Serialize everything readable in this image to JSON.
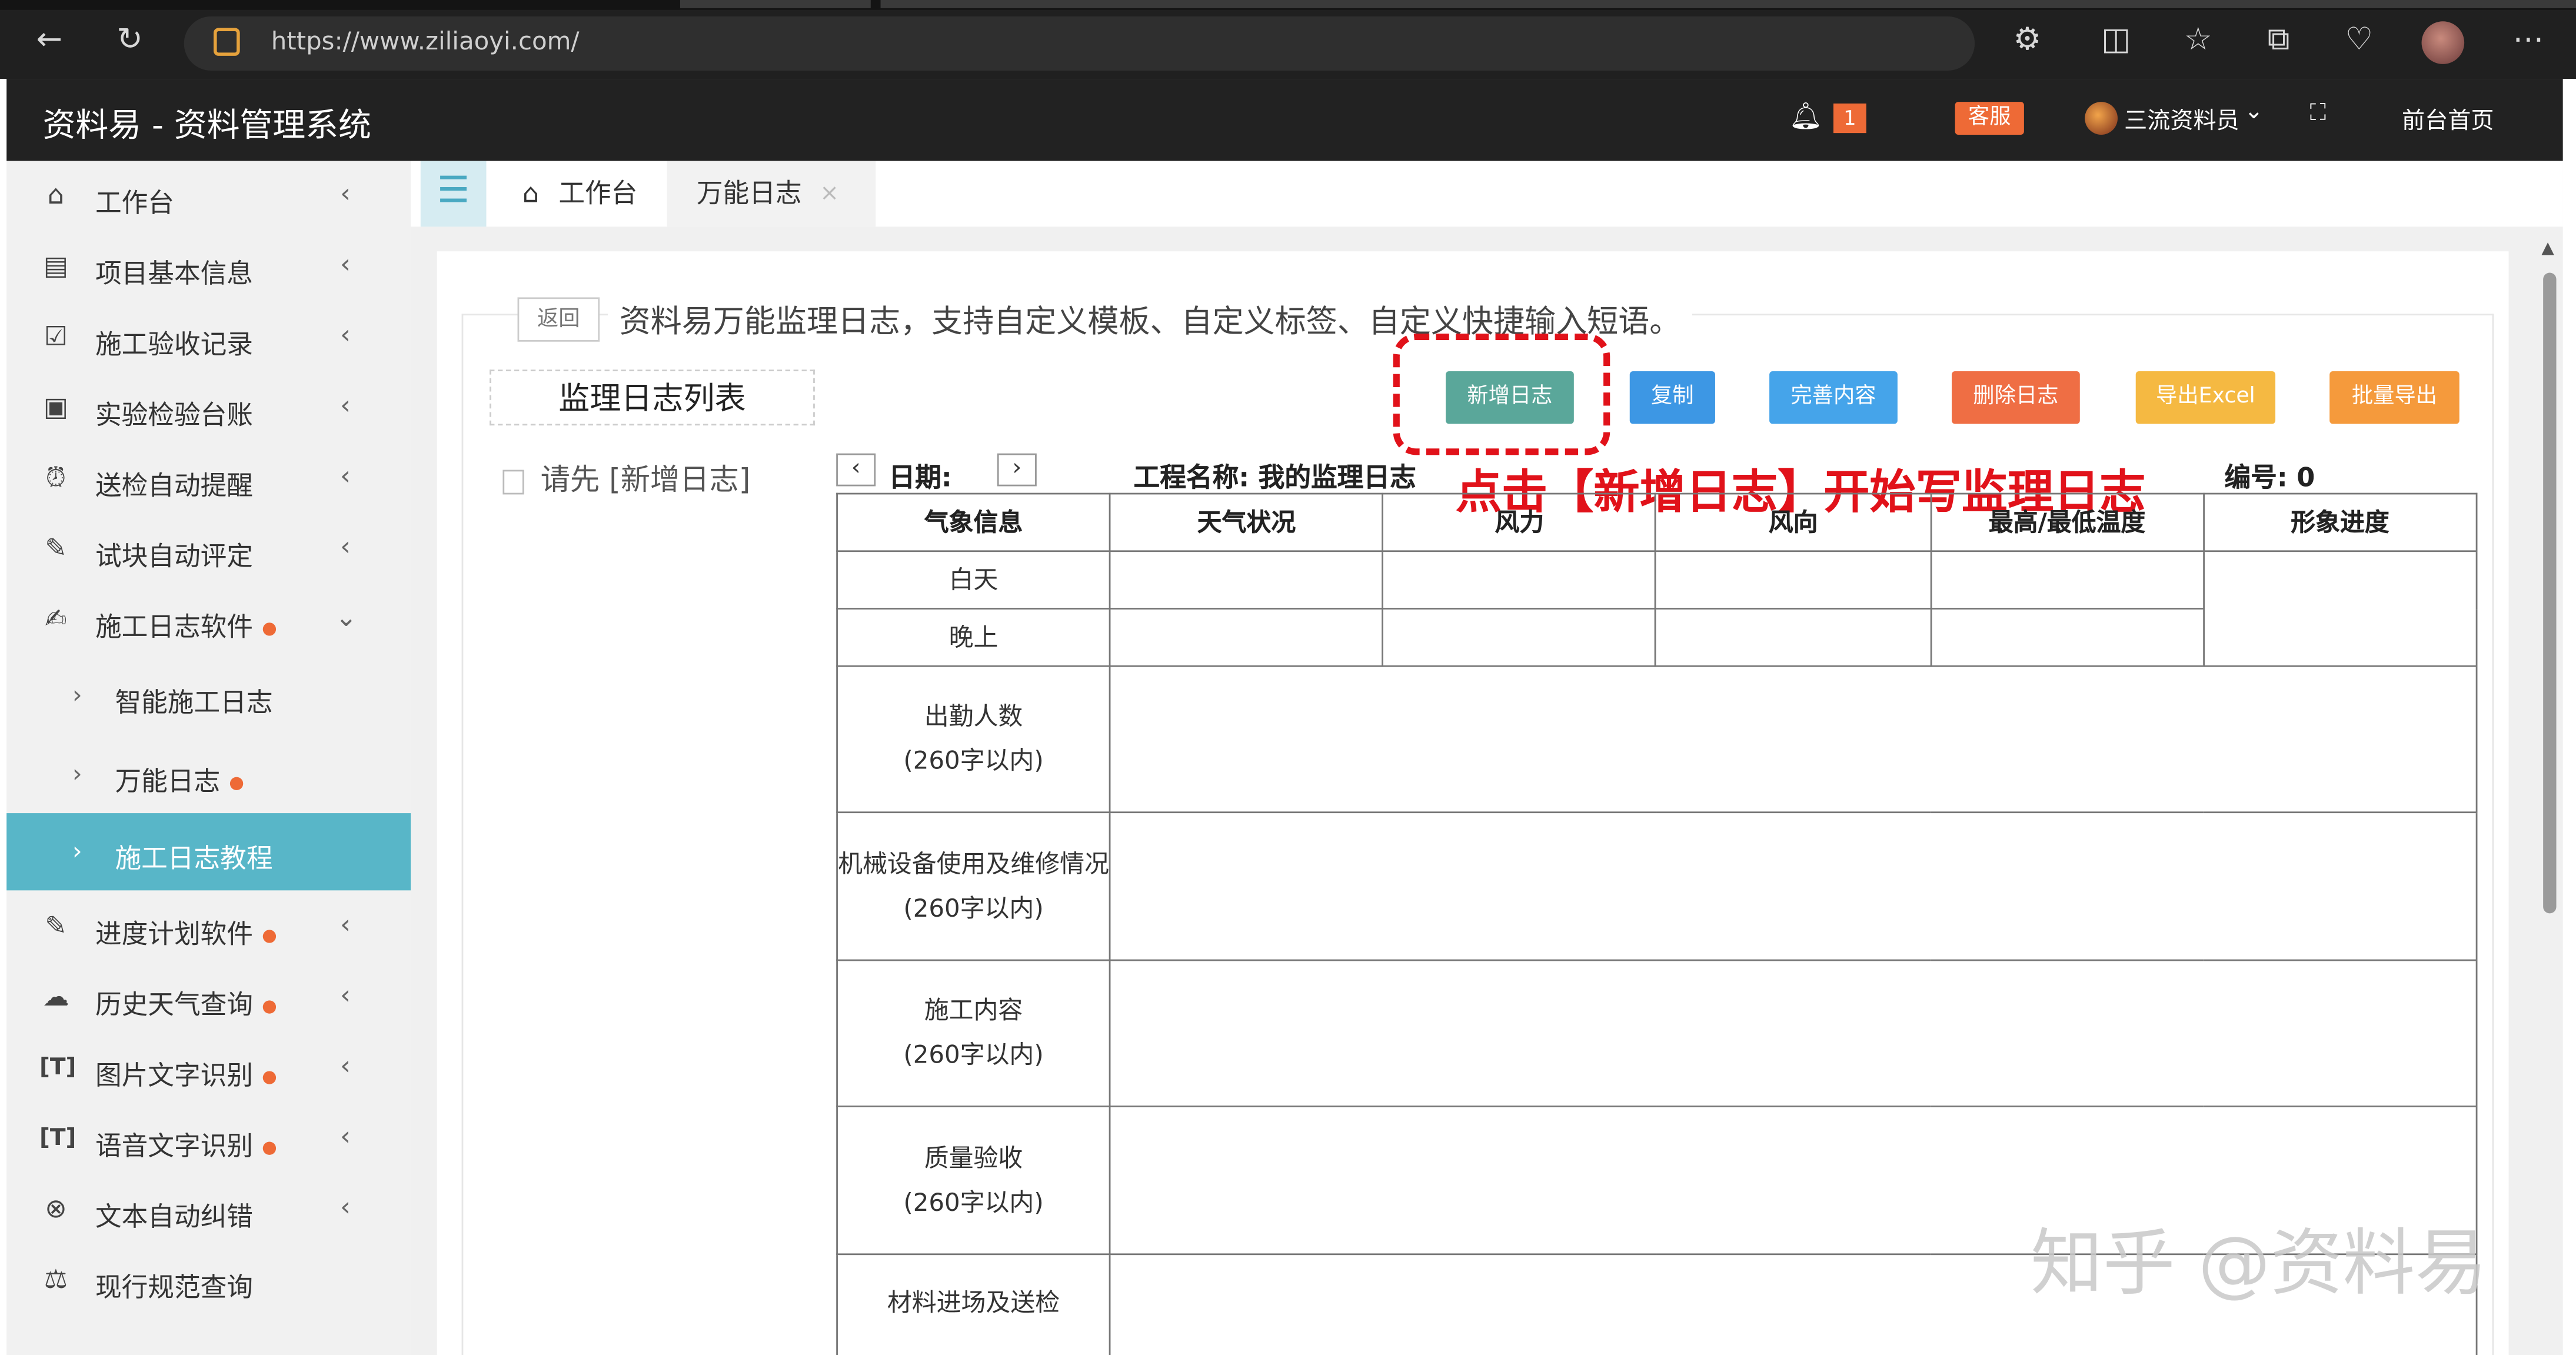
{
  "browser": {
    "url": "https://www.ziliaoyi.com/"
  },
  "header": {
    "app_title": "资料易 - 资料管理系统",
    "notification_count": "1",
    "support_label": "客服",
    "user_name": "三流资料员",
    "front_page_label": "前台首页"
  },
  "sidebar": {
    "items": [
      {
        "label": "工作台",
        "icon": "home-icon"
      },
      {
        "label": "项目基本信息",
        "icon": "document-icon"
      },
      {
        "label": "施工验收记录",
        "icon": "checklist-icon"
      },
      {
        "label": "实验检验台账",
        "icon": "inspection-icon"
      },
      {
        "label": "送检自动提醒",
        "icon": "alarm-clock-icon"
      },
      {
        "label": "试块自动评定",
        "icon": "assessment-icon"
      },
      {
        "label": "施工日志软件",
        "icon": "log-edit-icon"
      },
      {
        "label": "智能施工日志"
      },
      {
        "label": "万能日志"
      },
      {
        "label": "施工日志教程"
      },
      {
        "label": "进度计划软件",
        "icon": "schedule-icon"
      },
      {
        "label": "历史天气查询",
        "icon": "weather-icon"
      },
      {
        "label": "图片文字识别",
        "icon": "ocr-text-icon"
      },
      {
        "label": "语音文字识别",
        "icon": "voice-text-icon"
      },
      {
        "label": "文本自动纠错",
        "icon": "proofread-icon"
      },
      {
        "label": "现行规范查询",
        "icon": "scale-icon"
      }
    ]
  },
  "tabs": [
    {
      "label": "工作台",
      "icon": "home-icon"
    },
    {
      "label": "万能日志",
      "close": "×"
    }
  ],
  "page": {
    "back_label": "返回",
    "legend": "资料易万能监理日志，支持自定义模板、自定义标签、自定义快捷输入短语。",
    "list_title": "监理日志列表",
    "list_empty": "请先 [新增日志]",
    "buttons": {
      "add": "新增日志",
      "copy": "复制",
      "complete": "完善内容",
      "delete": "删除日志",
      "export_excel": "导出Excel",
      "batch_export": "批量导出"
    },
    "button_colors": {
      "add": "#5aa79a",
      "copy": "#3d97e4",
      "complete": "#45a4ea",
      "delete": "#ef6e44",
      "export_excel": "#f5b942",
      "batch_export": "#f59a3c"
    },
    "date_label": "日期:",
    "project_label": "工程名称: 我的监理日志",
    "number_label": "编号: 0",
    "annotation": "点击【新增日志】开始写监理日志"
  },
  "table": {
    "headers": [
      "气象信息",
      "天气状况",
      "风力",
      "风向",
      "最高/最低温度",
      "形象进度"
    ],
    "row_day": "白天",
    "row_night": "晚上",
    "sections": [
      {
        "title": "出勤人数",
        "note": "(260字以内)"
      },
      {
        "title": "机械设备使用及维修情况",
        "note": "(260字以内)"
      },
      {
        "title": "施工内容",
        "note": "(260字以内)"
      },
      {
        "title": "质量验收",
        "note": "(260字以内)"
      },
      {
        "title": "材料进场及送检",
        "note": ""
      }
    ]
  },
  "watermark": "知乎 @资料易"
}
